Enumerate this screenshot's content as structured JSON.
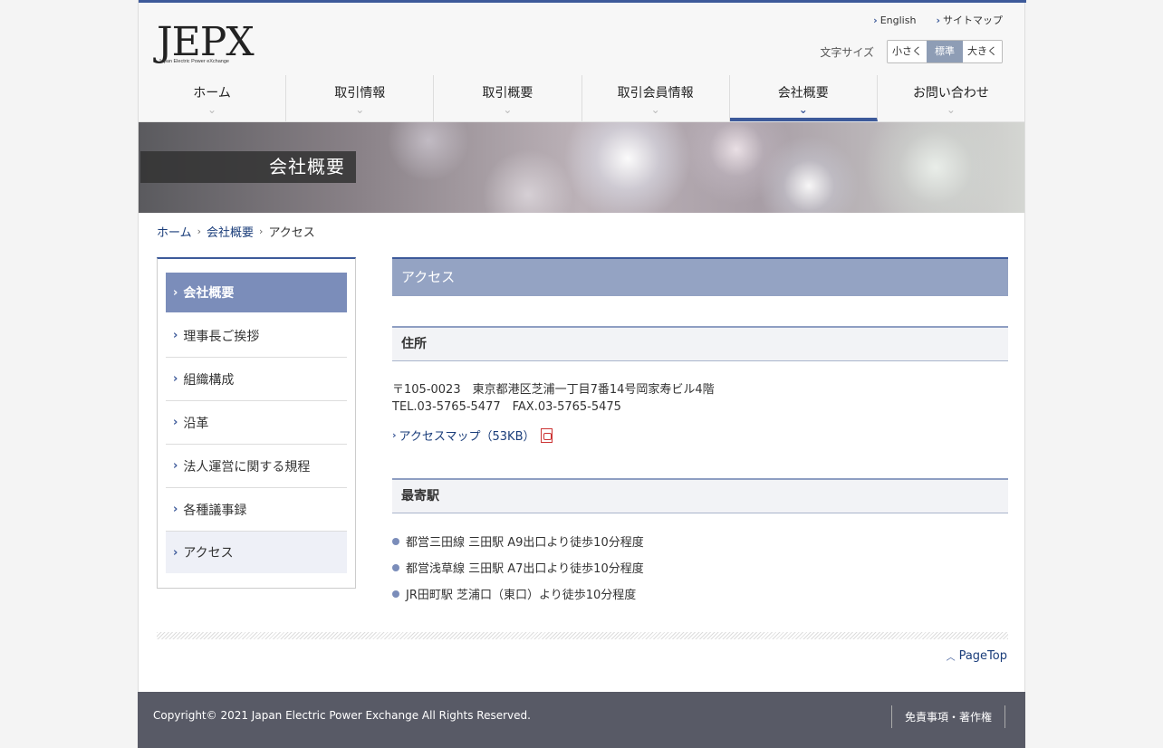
{
  "logo": {
    "text": "JEPX",
    "subtitle": "Japan Electric Power eXchange"
  },
  "toplinks": [
    {
      "label": "English"
    },
    {
      "label": "サイトマップ"
    }
  ],
  "fontsize": {
    "label": "文字サイズ",
    "options": [
      "小さく",
      "標準",
      "大きく"
    ],
    "selected": "標準"
  },
  "nav": [
    {
      "label": "ホーム"
    },
    {
      "label": "取引情報"
    },
    {
      "label": "取引概要"
    },
    {
      "label": "取引会員情報"
    },
    {
      "label": "会社概要"
    },
    {
      "label": "お問い合わせ"
    }
  ],
  "banner": {
    "title": "会社概要"
  },
  "breadcrumb": {
    "home": "ホーム",
    "section": "会社概要",
    "current": "アクセス"
  },
  "sidebar": {
    "head": "会社概要",
    "items": [
      "理事長ご挨拶",
      "組織構成",
      "沿革",
      "法人運営に関する規程",
      "各種議事録",
      "アクセス"
    ]
  },
  "main": {
    "title": "アクセス",
    "address_heading": "住所",
    "address_line1": "〒105-0023　東京都港区芝浦一丁目7番14号岡家寿ビル4階",
    "address_line2": "TEL.03-5765-5477　FAX.03-5765-5475",
    "map_link": "アクセスマップ（53KB）",
    "station_heading": "最寄駅",
    "stations": [
      "都営三田線 三田駅 A9出口より徒歩10分程度",
      "都営浅草線 三田駅 A7出口より徒歩10分程度",
      "JR田町駅 芝浦口（東口）より徒歩10分程度"
    ]
  },
  "pagetop": "PageTop",
  "footer": {
    "copyright": "Copyright© 2021 Japan Electric Power Exchange All Rights Reserved.",
    "link": "免責事項・著作権"
  },
  "colors": {
    "accent": "#3d5a9a",
    "sidebar_head": "#7b8dba",
    "footer_bg": "#585a66"
  }
}
